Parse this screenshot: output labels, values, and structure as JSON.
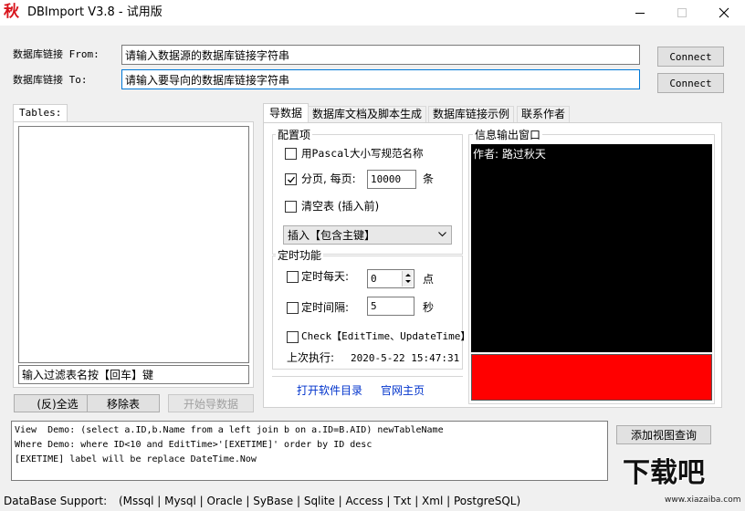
{
  "window": {
    "icon_char": "秋",
    "title": "DBImport V3.8 - 试用版"
  },
  "connection": {
    "from_label": "数据库链接 From:",
    "from_value": "请输入数据源的数据库链接字符串",
    "to_label": "数据库链接 To:",
    "to_value": "请输入要导向的数据库链接字符串",
    "connect_label": "Connect"
  },
  "tables": {
    "tab_label": "Tables:",
    "filter_value": "输入过滤表名按【回车】键",
    "select_all_label": "(反)全选",
    "remove_label": "移除表",
    "start_label": "开始导数据"
  },
  "tabs": [
    "导数据",
    "数据库文档及脚本生成",
    "数据库链接示例",
    "联系作者"
  ],
  "config": {
    "group_label": "配置项",
    "pascal_label": "用Pascal大小写规范名称",
    "pascal_checked": false,
    "paging_label": "分页, 每页:",
    "paging_checked": true,
    "paging_value": "10000",
    "paging_unit": "条",
    "clear_label": "清空表 (插入前)",
    "clear_checked": false,
    "insert_mode": "插入【包含主键】"
  },
  "timer": {
    "group_label": "定时功能",
    "daily_label": "定时每天:",
    "daily_value": "0",
    "daily_unit": "点",
    "interval_label": "定时间隔:",
    "interval_value": "5",
    "interval_unit": "秒",
    "check_label": "Check【EditTime、UpdateTime】",
    "last_run_label": "上次执行:",
    "last_run_value": "2020-5-22 15:47:31"
  },
  "links": {
    "open_dir": "打开软件目录",
    "homepage": "官网主页"
  },
  "output": {
    "group_label": "信息输出窗口",
    "text": "作者: 路过秋天",
    "status_color": "#ff0000"
  },
  "log": {
    "lines": "View  Demo: (select a.ID,b.Name from a left join b on a.ID=B.AID) newTableName\nWhere Demo: where ID<10 and EditTime>'[EXETIME]' order by ID desc\n[EXETIME] label will be replace DateTime.Now"
  },
  "view_query_label": "添加视图查询",
  "footer": {
    "label": "DataBase Support:",
    "items": "(Mssql | Mysql | Oracle | SyBase | Sqlite | Access | Txt | Xml | PostgreSQL)"
  },
  "watermark": {
    "text": "下载吧",
    "url": "www.xiazaiba.com"
  }
}
